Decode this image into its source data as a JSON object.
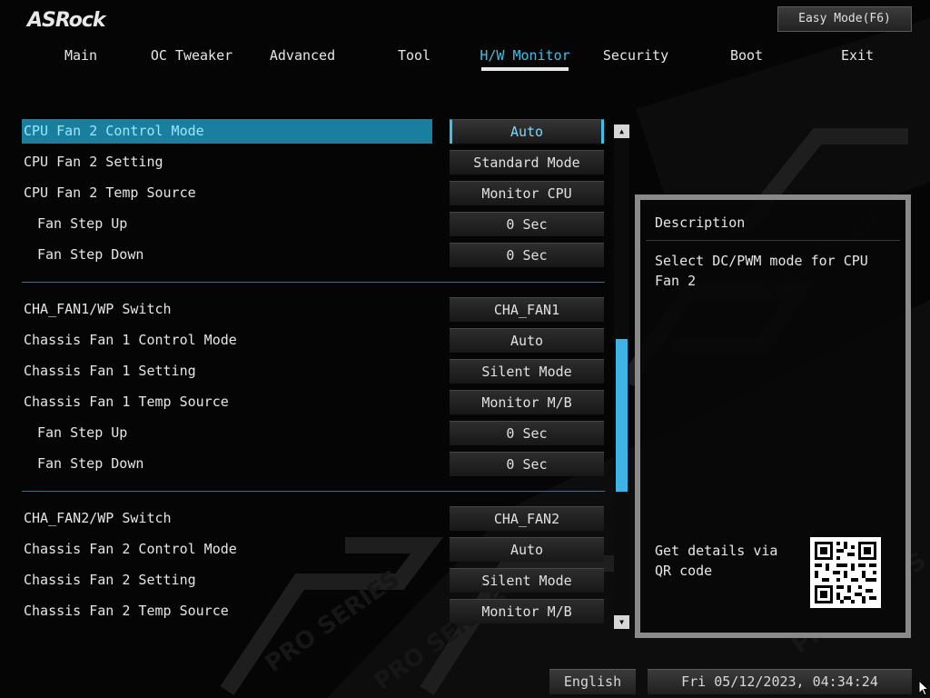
{
  "header": {
    "logo": "ASRock",
    "easy_mode_label": "Easy Mode(F6)"
  },
  "nav": {
    "tabs": [
      {
        "label": "Main"
      },
      {
        "label": "OC Tweaker"
      },
      {
        "label": "Advanced"
      },
      {
        "label": "Tool"
      },
      {
        "label": "H/W Monitor"
      },
      {
        "label": "Security"
      },
      {
        "label": "Boot"
      },
      {
        "label": "Exit"
      }
    ],
    "active": "H/W Monitor"
  },
  "settings": [
    {
      "label": "CPU Fan 2 Control Mode",
      "value": "Auto"
    },
    {
      "label": "CPU Fan 2 Setting",
      "value": "Standard Mode"
    },
    {
      "label": "CPU Fan 2 Temp Source",
      "value": "Monitor CPU"
    },
    {
      "label": "Fan Step Up",
      "value": "0 Sec"
    },
    {
      "label": "Fan Step Down",
      "value": "0 Sec"
    },
    {
      "label": "CHA_FAN1/WP Switch",
      "value": "CHA_FAN1"
    },
    {
      "label": "Chassis Fan 1 Control Mode",
      "value": "Auto"
    },
    {
      "label": "Chassis Fan 1 Setting",
      "value": "Silent Mode"
    },
    {
      "label": "Chassis Fan 1 Temp Source",
      "value": "Monitor M/B"
    },
    {
      "label": "Fan Step Up",
      "value": "0 Sec"
    },
    {
      "label": "Fan Step Down",
      "value": "0 Sec"
    },
    {
      "label": "CHA_FAN2/WP Switch",
      "value": "CHA_FAN2"
    },
    {
      "label": "Chassis Fan 2 Control Mode",
      "value": "Auto"
    },
    {
      "label": "Chassis Fan 2 Setting",
      "value": "Silent Mode"
    },
    {
      "label": "Chassis Fan 2 Temp Source",
      "value": "Monitor M/B"
    }
  ],
  "description": {
    "title": "Description",
    "text": "Select DC/PWM mode for CPU Fan 2",
    "qr_text": "Get details via QR code"
  },
  "footer": {
    "language": "English",
    "datetime": "Fri 05/12/2023, 04:34:24"
  },
  "colors": {
    "accent": "#3ec0ee",
    "highlight_row": "#1a7e9e",
    "background": "#050505"
  }
}
